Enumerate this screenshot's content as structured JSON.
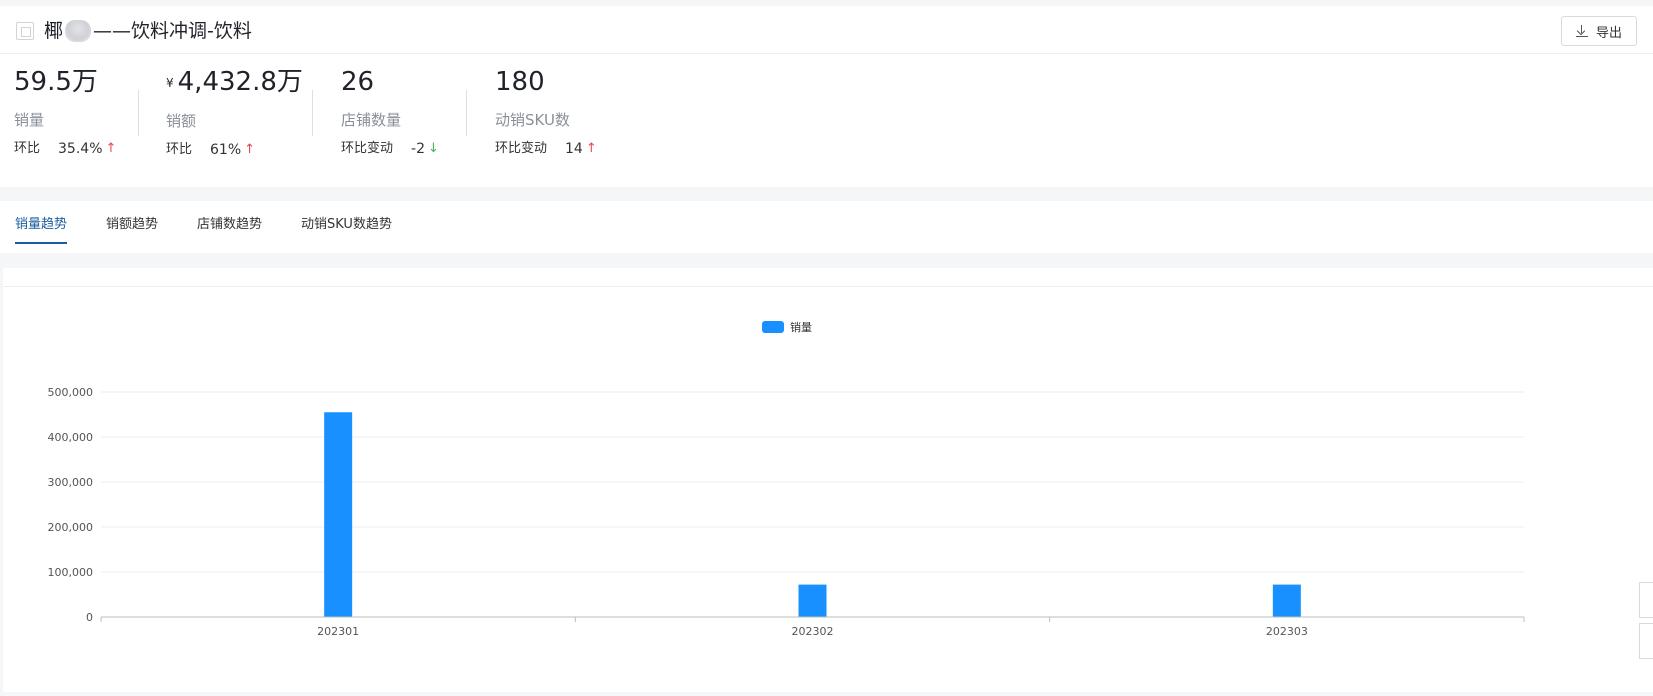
{
  "header": {
    "title_prefix": "椰",
    "title_suffix": "——饮料冲调-饮料",
    "export_label": "导出"
  },
  "metrics": [
    {
      "value": "59.5万",
      "currency": "",
      "label": "销量",
      "cmp_label": "环比",
      "cmp_value": "35.4%",
      "trend": "up"
    },
    {
      "value": "4,432.8万",
      "currency": "¥",
      "label": "销额",
      "cmp_label": "环比",
      "cmp_value": "61%",
      "trend": "up"
    },
    {
      "value": "26",
      "currency": "",
      "label": "店铺数量",
      "cmp_label": "环比变动",
      "cmp_value": "-2",
      "trend": "down"
    },
    {
      "value": "180",
      "currency": "",
      "label": "动销SKU数",
      "cmp_label": "环比变动",
      "cmp_value": "14",
      "trend": "up"
    }
  ],
  "tabs": [
    {
      "label": "销量趋势",
      "active": true
    },
    {
      "label": "销额趋势",
      "active": false
    },
    {
      "label": "店铺数趋势",
      "active": false
    },
    {
      "label": "动销SKU数趋势",
      "active": false
    }
  ],
  "colors": {
    "bar": "#1890ff",
    "up": "#e5484d",
    "down": "#3fb950",
    "tab_active": "#1a5c9e"
  },
  "chart_data": {
    "type": "bar",
    "categories": [
      "202301",
      "202302",
      "202303"
    ],
    "series": [
      {
        "name": "销量",
        "values": [
          455000,
          72000,
          72000
        ]
      }
    ],
    "ylim": [
      0,
      500000
    ],
    "yticks": [
      "0",
      "100,000",
      "200,000",
      "300,000",
      "400,000",
      "500,000"
    ],
    "legend": "top-center",
    "grid": true
  }
}
